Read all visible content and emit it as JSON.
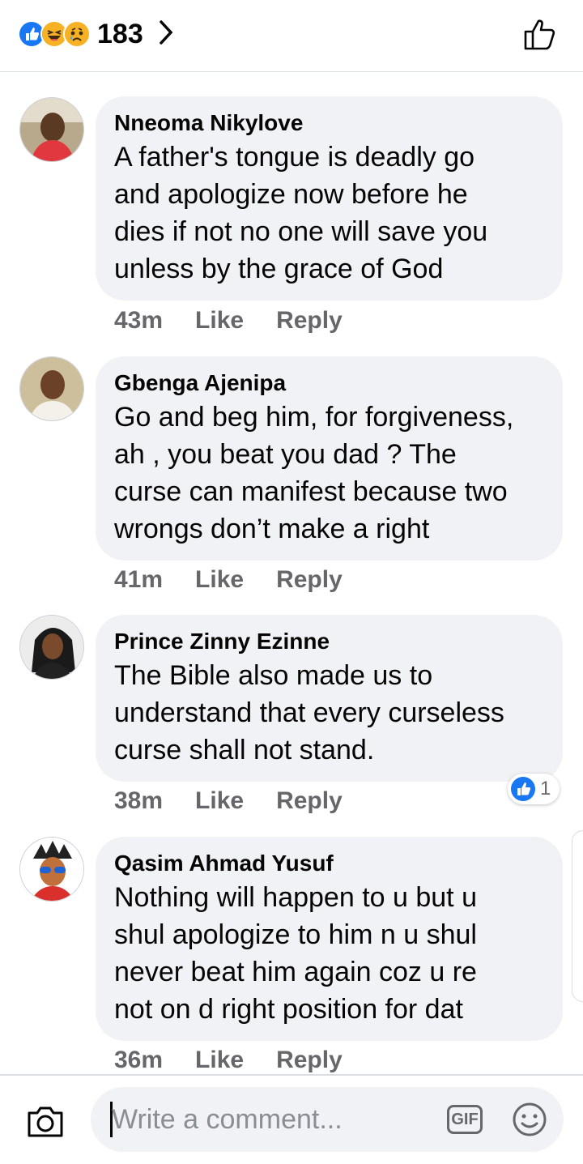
{
  "header": {
    "reaction_icons": [
      "like-reaction",
      "haha-reaction",
      "sad-reaction"
    ],
    "reaction_count": "183"
  },
  "comments": [
    {
      "author": "Nneoma Nikylove",
      "text": "A father's tongue is deadly go\nand apologize now before he\ndies if not no one will save you\nunless by the grace of God",
      "time": "43m",
      "like_label": "Like",
      "reply_label": "Reply"
    },
    {
      "author": "Gbenga Ajenipa",
      "text": "Go and beg him, for forgiveness,\nah , you beat you dad ? The\ncurse can manifest because two\nwrongs don’t make a right",
      "time": "41m",
      "like_label": "Like",
      "reply_label": "Reply"
    },
    {
      "author": "Prince Zinny Ezinne",
      "text": "The Bible also made us to\nunderstand that every curseless\ncurse shall not stand.",
      "time": "38m",
      "like_label": "Like",
      "reply_label": "Reply",
      "reaction_count": "1"
    },
    {
      "author": "Qasim Ahmad Yusuf",
      "text": "Nothing will happen to u but u\nshul apologize to him n u shul\nnever beat him again coz u re\nnot on d right position for dat",
      "time": "36m",
      "like_label": "Like",
      "reply_label": "Reply"
    }
  ],
  "composer": {
    "placeholder": "Write a comment...",
    "gif_label": "GIF"
  },
  "colors": {
    "like_blue": "#1877f2",
    "bubble_bg": "#f0f2f5",
    "meta_gray": "#65676b"
  }
}
